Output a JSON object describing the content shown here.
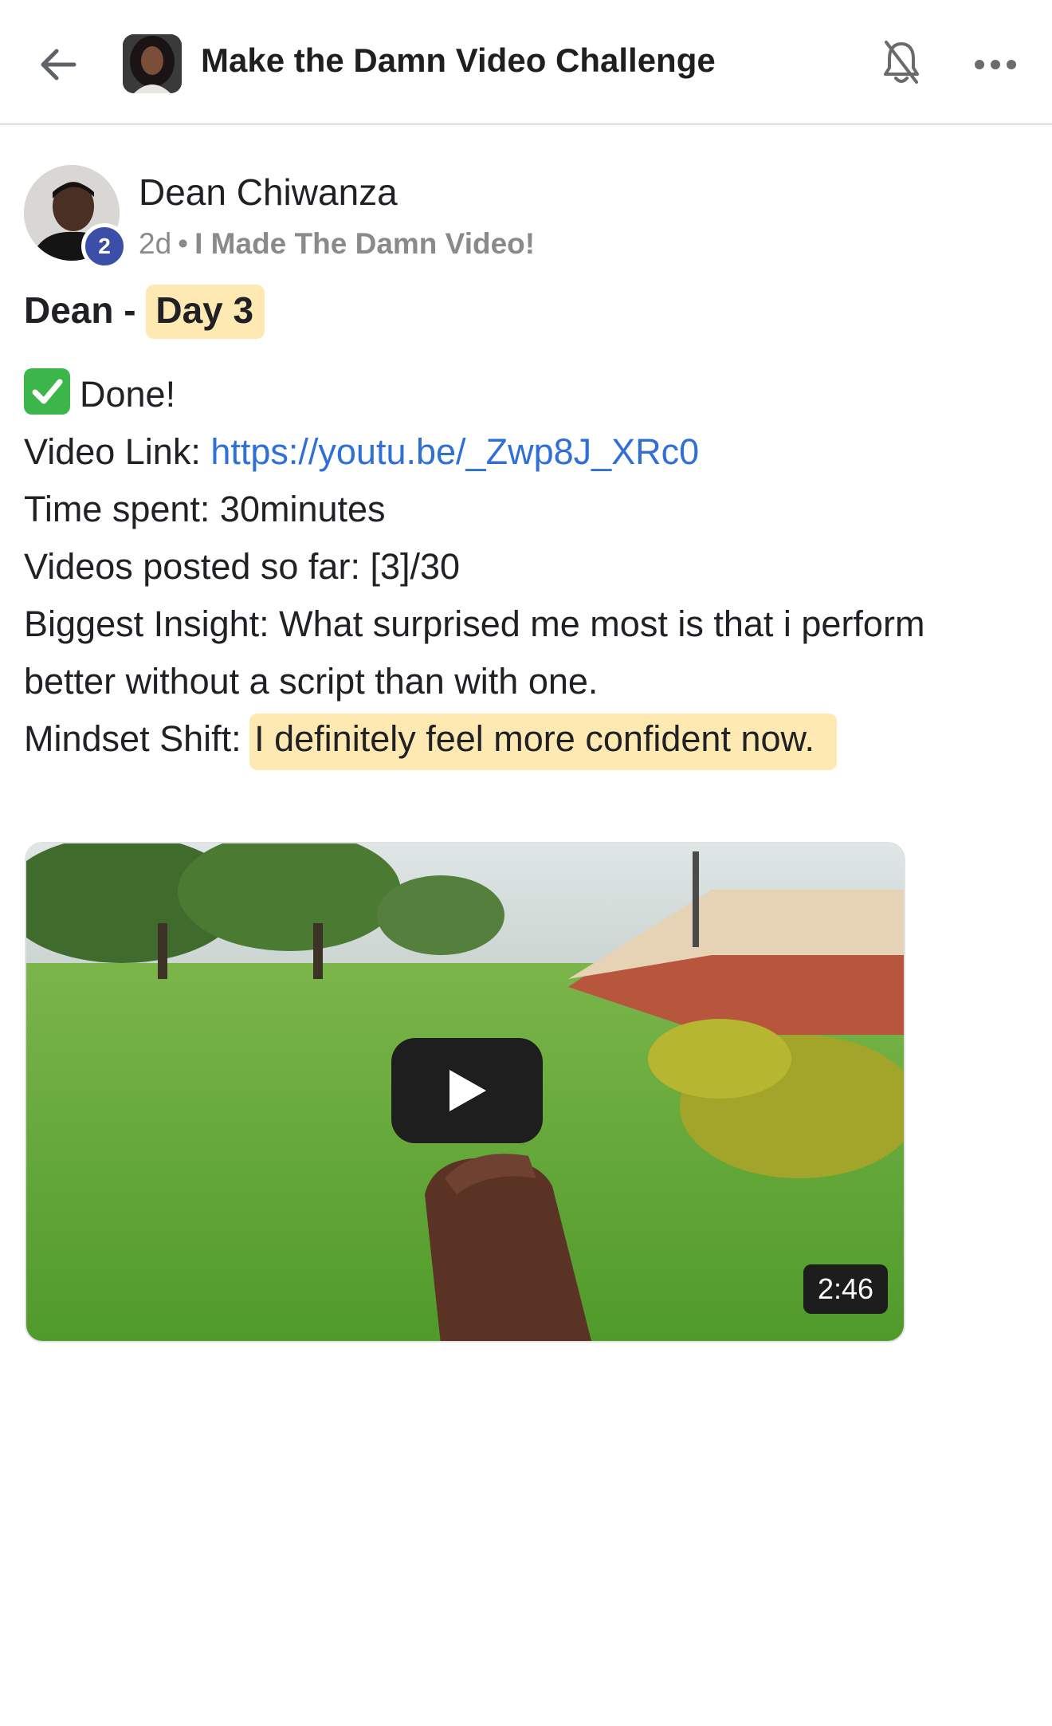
{
  "header": {
    "title": "Make the Damn Video Challenge"
  },
  "post": {
    "author": "Dean Chiwanza",
    "level": "2",
    "time_ago": "2d",
    "separator": "•",
    "category": "I Made The Damn Video!",
    "title_prefix": "Dean - ",
    "title_highlight": "Day 3",
    "done_text": "Done!",
    "video_link_label": "Video Link: ",
    "video_link_url": "https://youtu.be/_Zwp8J_XRc0",
    "time_spent": "Time spent: 30minutes",
    "videos_posted": "Videos posted so far: [3]/30",
    "insight_line1": "Biggest Insight: What surprised me most is that i perform",
    "insight_line2": "better without a script than with one.",
    "mindset_label": "Mindset Shift: ",
    "mindset_text": "I definitely feel more confident now."
  },
  "video": {
    "duration": "2:46"
  },
  "colors": {
    "highlight": "#ffe9b3",
    "link": "#2f6fd6",
    "badge": "#3b4fa8",
    "check": "#3cb64a"
  },
  "icons": [
    "back-arrow-icon",
    "bell-off-icon",
    "more-dots-icon",
    "check-mark-icon",
    "play-icon"
  ]
}
